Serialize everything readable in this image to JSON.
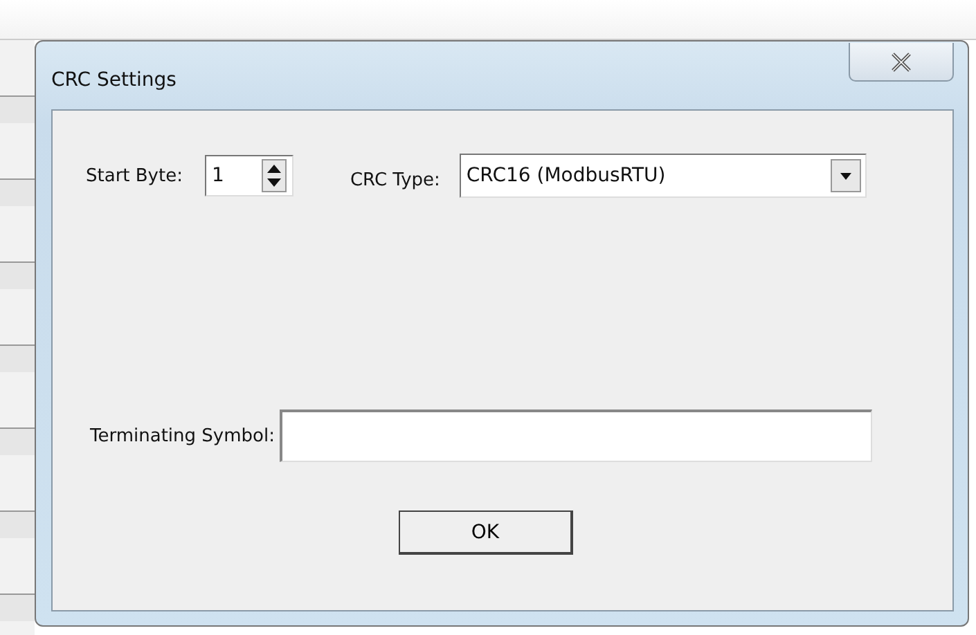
{
  "window": {
    "title": "CRC Settings"
  },
  "start_byte": {
    "label": "Start Byte:",
    "value": "1"
  },
  "crc_type": {
    "label": "CRC Type:",
    "value": "CRC16 (ModbusRTU)"
  },
  "terminating_symbol": {
    "label": "Terminating Symbol:"
  },
  "buttons": [
    "OK"
  ]
}
